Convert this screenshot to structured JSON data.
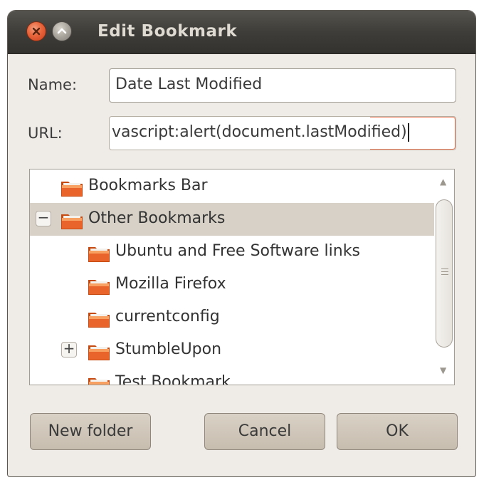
{
  "window": {
    "title": "Edit Bookmark",
    "title_buttons": [
      {
        "name": "close-icon",
        "color": "#e8643a"
      },
      {
        "name": "maximize-icon",
        "color": "#a9a59d"
      }
    ]
  },
  "form": {
    "name_label": "Name:",
    "name_value": "Date Last Modified",
    "url_label": "URL:",
    "url_value": "vascript:alert(document.lastModified)"
  },
  "folder_tree": {
    "items": [
      {
        "label": "Bookmarks Bar",
        "icon": "folder-icon",
        "expander": ""
      },
      {
        "label": "Other Bookmarks",
        "icon": "folder-icon",
        "expander": "−",
        "selected": true
      },
      {
        "label": "Ubuntu and Free Software links",
        "icon": "folder-icon",
        "expander": ""
      },
      {
        "label": "Mozilla Firefox",
        "icon": "folder-icon",
        "expander": ""
      },
      {
        "label": "currentconfig",
        "icon": "folder-icon",
        "expander": ""
      },
      {
        "label": "StumbleUpon",
        "icon": "folder-icon",
        "expander": "+"
      },
      {
        "label": "Test Bookmark",
        "icon": "folder-icon",
        "expander": ""
      }
    ],
    "scroll_up_icon": "▲",
    "scroll_down_icon": "▼"
  },
  "buttons": {
    "new_folder": "New folder",
    "cancel": "Cancel",
    "ok": "OK"
  },
  "colors": {
    "title_bar": "#3f3d39",
    "selection": "#d7d1c7",
    "folder": "#e8642a",
    "focus": "#f08060"
  }
}
